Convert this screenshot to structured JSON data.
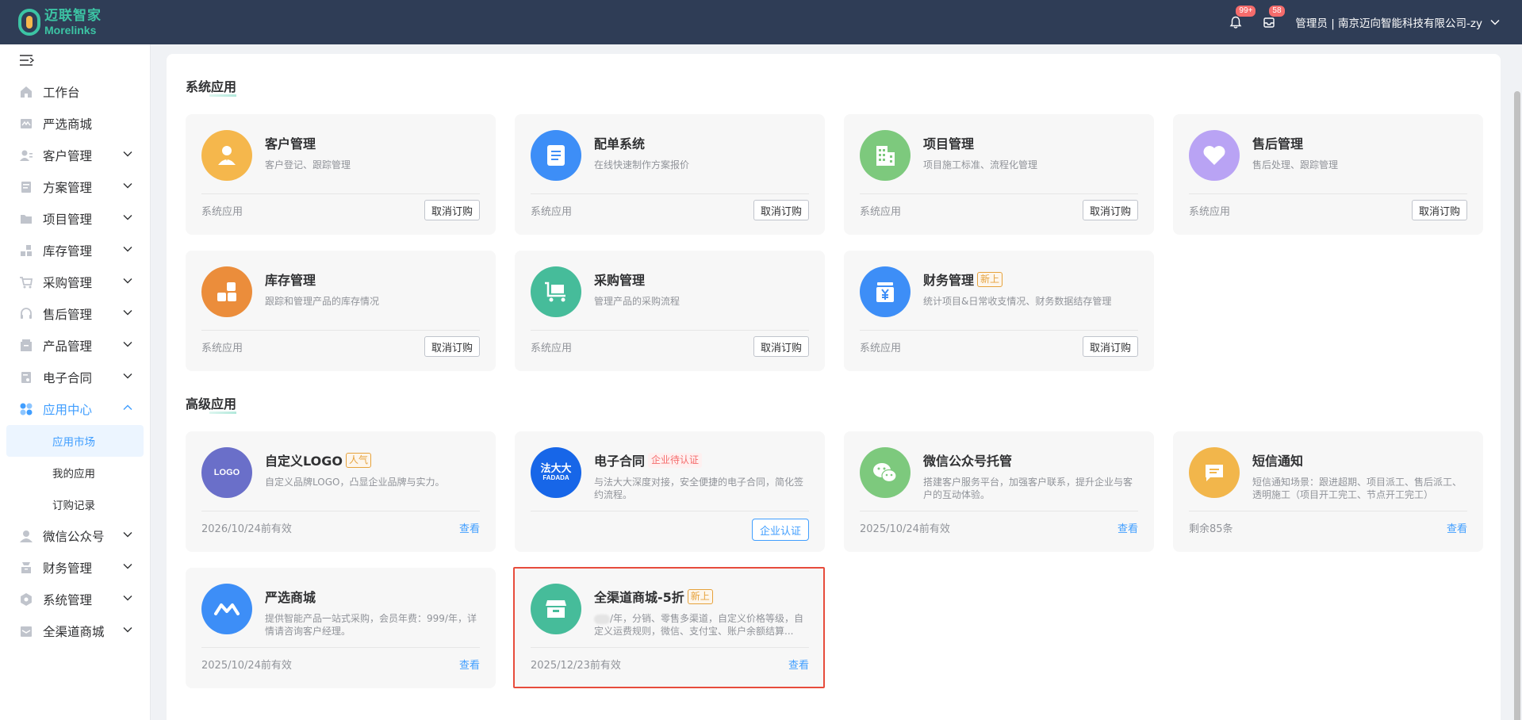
{
  "header": {
    "brand_cn": "迈联智家",
    "brand_en": "Morelinks",
    "bell_badge": "99+",
    "msg_badge": "58",
    "user": "管理员 | 南京迈向智能科技有限公司-zy",
    "bg_color": "#2f3d56"
  },
  "sidebar": {
    "items": [
      {
        "label": "工作台",
        "icon": "home-icon"
      },
      {
        "label": "严选商城",
        "icon": "mall-icon"
      },
      {
        "label": "客户管理",
        "icon": "customer-icon"
      },
      {
        "label": "方案管理",
        "icon": "plan-icon"
      },
      {
        "label": "项目管理",
        "icon": "folder-icon"
      },
      {
        "label": "库存管理",
        "icon": "inventory-icon"
      },
      {
        "label": "采购管理",
        "icon": "cart-icon"
      },
      {
        "label": "售后管理",
        "icon": "headset-icon"
      },
      {
        "label": "产品管理",
        "icon": "product-icon"
      },
      {
        "label": "电子合同",
        "icon": "contract-icon"
      },
      {
        "label": "应用中心",
        "icon": "apps-icon"
      }
    ],
    "sub_items": [
      {
        "label": "应用市场"
      },
      {
        "label": "我的应用"
      },
      {
        "label": "订购记录"
      }
    ],
    "items_after": [
      {
        "label": "微信公众号",
        "icon": "wechat-icon"
      },
      {
        "label": "财务管理",
        "icon": "finance-icon"
      },
      {
        "label": "系统管理",
        "icon": "settings-icon"
      },
      {
        "label": "全渠道商城",
        "icon": "store-icon"
      }
    ]
  },
  "system_apps": {
    "title": "系统应用",
    "cards": [
      {
        "title": "客户管理",
        "desc": "客户登记、跟踪管理",
        "footer": "系统应用",
        "button": "取消订购",
        "icon": "person-icon",
        "color": "#f5b74c"
      },
      {
        "title": "配单系统",
        "desc": "在线快速制作方案报价",
        "footer": "系统应用",
        "button": "取消订购",
        "icon": "document-icon",
        "color": "#3d8ef7"
      },
      {
        "title": "项目管理",
        "desc": "项目施工标准、流程化管理",
        "footer": "系统应用",
        "button": "取消订购",
        "icon": "building-icon",
        "color": "#7dc97d"
      },
      {
        "title": "售后管理",
        "desc": "售后处理、跟踪管理",
        "footer": "系统应用",
        "button": "取消订购",
        "icon": "heart-icon",
        "color": "#b9a3f4"
      },
      {
        "title": "库存管理",
        "desc": "跟踪和管理产品的库存情况",
        "footer": "系统应用",
        "button": "取消订购",
        "icon": "boxes-icon",
        "color": "#eb8d3b"
      },
      {
        "title": "采购管理",
        "desc": "管理产品的采购流程",
        "footer": "系统应用",
        "button": "取消订购",
        "icon": "trolley-icon",
        "color": "#46bc9a"
      },
      {
        "title": "财务管理",
        "tag": "新上",
        "desc": "统计项目&日常收支情况、财务数据结存管理",
        "footer": "系统应用",
        "button": "取消订购",
        "icon": "yen-icon",
        "color": "#3d8ef7"
      }
    ]
  },
  "advanced_apps": {
    "title": "高级应用",
    "cards": [
      {
        "title": "自定义LOGO",
        "tag": "人气",
        "desc": "自定义品牌LOGO，凸显企业品牌与实力。",
        "footer": "2026/10/24前有效",
        "action": "查看",
        "icon_text": "LOGO",
        "color": "#6a6fc9"
      },
      {
        "title": "电子合同",
        "tag": "企业待认证",
        "desc": "与法大大深度对接，安全便捷的电子合同，简化签约流程。",
        "action": "企业认证",
        "icon_text": "法大大",
        "icon_sub": "FADADA",
        "color": "#1766e8"
      },
      {
        "title": "微信公众号托管",
        "desc": "搭建客户服务平台，加强客户联系，提升企业与客户的互动体验。",
        "footer": "2025/10/24前有效",
        "action": "查看",
        "icon": "wechat-icon",
        "color": "#7dc97d"
      },
      {
        "title": "短信通知",
        "desc": "短信通知场景：跟进超期、项目派工、售后派工、透明施工（项目开工完工、节点开工完工）",
        "footer": "剩余85条",
        "action": "查看",
        "icon": "sms-icon",
        "color": "#f2b64b"
      },
      {
        "title": "严选商城",
        "desc": "提供智能产品一站式采购，会员年费：999/年，详情请咨询客户经理。",
        "footer": "2025/10/24前有效",
        "action": "查看",
        "icon": "mall-logo-icon",
        "color": "#3d8ef7"
      },
      {
        "title": "全渠道商城-5折",
        "tag": "新上",
        "desc": "/年，分销、零售多渠道，自定义价格等级，自定义运费规则，微信、支付宝、账户余额结算...",
        "footer": "2025/12/23前有效",
        "action": "查看",
        "icon": "store-icon",
        "color": "#46bc9a"
      }
    ]
  }
}
